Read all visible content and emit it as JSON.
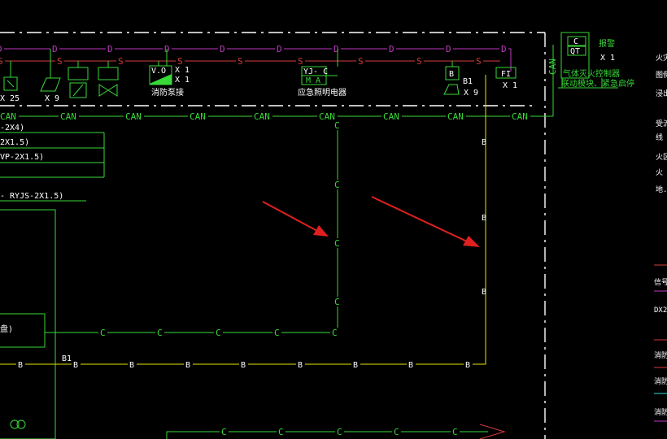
{
  "bus_labels": {
    "can": "CAN",
    "d": "D",
    "s": "S",
    "c": "C",
    "b": "B"
  },
  "devices": {
    "module_counts": [
      "X 25",
      "X 9",
      "X 1",
      "X 1",
      "X 9",
      "X 1"
    ],
    "sprinkler": {
      "code": "V.O",
      "x1a": "X 1",
      "x1b": "X 1",
      "caption": "消防泵接"
    },
    "yj_module": {
      "code": "YJ- C",
      "sub": "M  A",
      "caption": "应急照明电器"
    },
    "broadcast": {
      "code": "B",
      "tag": "B1",
      "count": "X 9"
    },
    "fi": {
      "code": "FI",
      "count": "X 1"
    },
    "panel": {
      "c": "C",
      "qt": "QT",
      "side": "报警",
      "count": "X 1",
      "caption1": "气体灭火控制器",
      "caption2": "联动模块、紧急启停"
    }
  },
  "left_cables": [
    "-2X4)",
    "2X1.5)",
    "VP-2X1.5)",
    "- RYJS-2X1.5)"
  ],
  "left_box_label": "盘)",
  "bus_tag_b1": "B1",
  "right_notes": [
    "火灾自",
    "图例",
    "浸出",
    "受流",
    "线",
    "火区",
    "火",
    "地."
  ],
  "legend_right": [
    "信号-",
    "DX2",
    "消防",
    "消防广",
    "消防"
  ]
}
